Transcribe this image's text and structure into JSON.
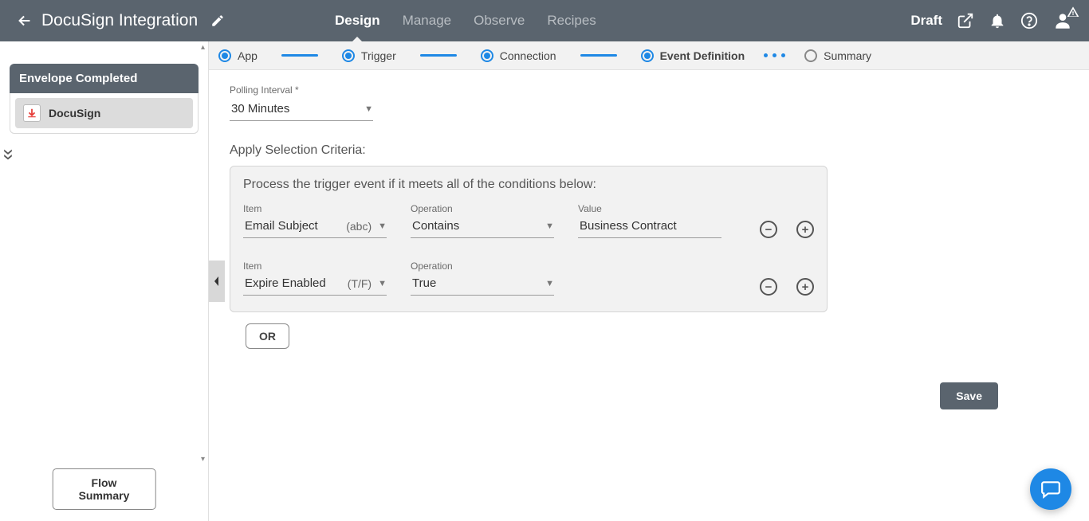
{
  "header": {
    "title": "DocuSign Integration",
    "status": "Draft",
    "tabs": [
      {
        "label": "Design",
        "active": true
      },
      {
        "label": "Manage",
        "active": false
      },
      {
        "label": "Observe",
        "active": false
      },
      {
        "label": "Recipes",
        "active": false
      }
    ]
  },
  "sidebar": {
    "panel_title": "Envelope Completed",
    "app": {
      "name": "DocuSign"
    },
    "flow_summary_label": "Flow Summary"
  },
  "stepper": [
    {
      "label": "App",
      "state": "done"
    },
    {
      "label": "Trigger",
      "state": "done"
    },
    {
      "label": "Connection",
      "state": "done"
    },
    {
      "label": "Event Definition",
      "state": "current"
    },
    {
      "label": "Summary",
      "state": "pending"
    }
  ],
  "form": {
    "polling": {
      "label": "Polling Interval *",
      "value": "30 Minutes"
    },
    "criteria_title": "Apply Selection Criteria:",
    "criteria_desc": "Process the trigger event if it meets all of the conditions below:",
    "headers": {
      "item": "Item",
      "operation": "Operation",
      "value": "Value"
    },
    "rows": [
      {
        "item": "Email Subject",
        "type_hint": "(abc)",
        "operation": "Contains",
        "value": "Business Contract",
        "has_value": true
      },
      {
        "item": "Expire Enabled",
        "type_hint": "(T/F)",
        "operation": "True",
        "value": "",
        "has_value": false
      }
    ],
    "or_label": "OR",
    "save_label": "Save"
  }
}
